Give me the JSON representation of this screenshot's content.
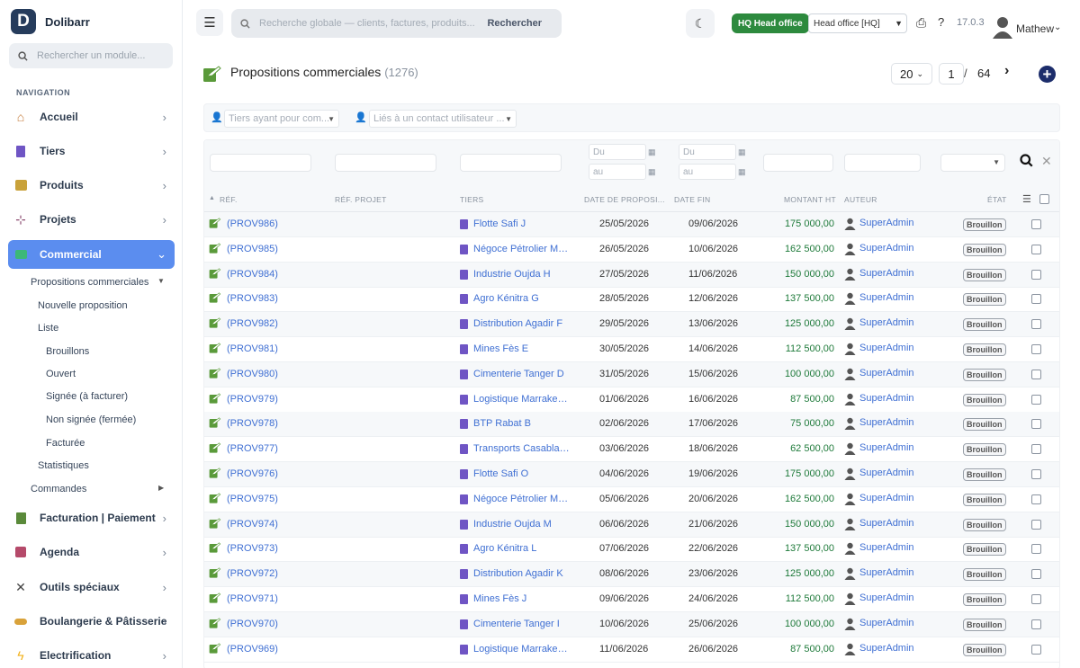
{
  "app": {
    "name": "Dolibarr",
    "logo_letter": "D"
  },
  "sidebar": {
    "search_placeholder": "Rechercher un module...",
    "nav_heading": "NAVIGATION",
    "items": [
      {
        "label": "Accueil",
        "icon": "home-icon"
      },
      {
        "label": "Tiers",
        "icon": "building-icon"
      },
      {
        "label": "Produits",
        "icon": "box-icon"
      },
      {
        "label": "Projets",
        "icon": "sitemap-icon"
      },
      {
        "label": "Commercial",
        "icon": "briefcase-icon"
      },
      {
        "label": "Facturation | Paiement",
        "icon": "invoice-icon"
      },
      {
        "label": "Agenda",
        "icon": "calendar-icon"
      },
      {
        "label": "Outils spéciaux",
        "icon": "tools-icon"
      },
      {
        "label": "Boulangerie & Pâtisserie",
        "icon": "bread-icon"
      },
      {
        "label": "Electrification",
        "icon": "bolt-icon"
      }
    ],
    "submenu": {
      "propositions": "Propositions commerciales",
      "nouvelle": "Nouvelle proposition",
      "liste": "Liste",
      "brouillons": "Brouillons",
      "ouvert": "Ouvert",
      "signee": "Signée (à facturer)",
      "non_signee": "Non signée (fermée)",
      "facturee": "Facturée",
      "statistiques": "Statistiques",
      "commandes": "Commandes"
    }
  },
  "header": {
    "search_placeholder": "Recherche globale — clients, factures, produits...",
    "search_button": "Rechercher",
    "hq_badge": "HQ  Head office",
    "entity": "Head office [HQ]",
    "version": "17.0.3",
    "user": "Mathew"
  },
  "page": {
    "title": "Propositions commerciales",
    "count": "(1276)",
    "page_size": "20",
    "page_current": "1",
    "page_separator": "/",
    "page_total": "64"
  },
  "filters": {
    "thirdparty_placeholder": "Tiers ayant pour com...",
    "contact_placeholder": "Liés à un contact utilisateur ..."
  },
  "search_row": {
    "date_from": "Du",
    "date_to": "au"
  },
  "columns": {
    "ref": "RÉF.",
    "ref_project": "RÉF. PROJET",
    "tiers": "TIERS",
    "date": "DATE DE PROPOSI...",
    "date_end": "DATE FIN",
    "amount": "MONTANT HT",
    "author": "AUTEUR",
    "status": "ÉTAT"
  },
  "rows": [
    {
      "ref": "(PROV986)",
      "tiers": "Flotte Safi J",
      "date": "25/05/2026",
      "date_end": "09/06/2026",
      "amount": "175 000,00",
      "author": "SuperAdmin",
      "status": "Brouillon"
    },
    {
      "ref": "(PROV985)",
      "tiers": "Négoce Pétrolier Mo...",
      "date": "26/05/2026",
      "date_end": "10/06/2026",
      "amount": "162 500,00",
      "author": "SuperAdmin",
      "status": "Brouillon"
    },
    {
      "ref": "(PROV984)",
      "tiers": "Industrie Oujda H",
      "date": "27/05/2026",
      "date_end": "11/06/2026",
      "amount": "150 000,00",
      "author": "SuperAdmin",
      "status": "Brouillon"
    },
    {
      "ref": "(PROV983)",
      "tiers": "Agro Kénitra G",
      "date": "28/05/2026",
      "date_end": "12/06/2026",
      "amount": "137 500,00",
      "author": "SuperAdmin",
      "status": "Brouillon"
    },
    {
      "ref": "(PROV982)",
      "tiers": "Distribution Agadir F",
      "date": "29/05/2026",
      "date_end": "13/06/2026",
      "amount": "125 000,00",
      "author": "SuperAdmin",
      "status": "Brouillon"
    },
    {
      "ref": "(PROV981)",
      "tiers": "Mines Fès E",
      "date": "30/05/2026",
      "date_end": "14/06/2026",
      "amount": "112 500,00",
      "author": "SuperAdmin",
      "status": "Brouillon"
    },
    {
      "ref": "(PROV980)",
      "tiers": "Cimenterie Tanger D",
      "date": "31/05/2026",
      "date_end": "15/06/2026",
      "amount": "100 000,00",
      "author": "SuperAdmin",
      "status": "Brouillon"
    },
    {
      "ref": "(PROV979)",
      "tiers": "Logistique Marrakec...",
      "date": "01/06/2026",
      "date_end": "16/06/2026",
      "amount": "87 500,00",
      "author": "SuperAdmin",
      "status": "Brouillon"
    },
    {
      "ref": "(PROV978)",
      "tiers": "BTP Rabat B",
      "date": "02/06/2026",
      "date_end": "17/06/2026",
      "amount": "75 000,00",
      "author": "SuperAdmin",
      "status": "Brouillon"
    },
    {
      "ref": "(PROV977)",
      "tiers": "Transports Casablan...",
      "date": "03/06/2026",
      "date_end": "18/06/2026",
      "amount": "62 500,00",
      "author": "SuperAdmin",
      "status": "Brouillon"
    },
    {
      "ref": "(PROV976)",
      "tiers": "Flotte Safi O",
      "date": "04/06/2026",
      "date_end": "19/06/2026",
      "amount": "175 000,00",
      "author": "SuperAdmin",
      "status": "Brouillon"
    },
    {
      "ref": "(PROV975)",
      "tiers": "Négoce Pétrolier Mo...",
      "date": "05/06/2026",
      "date_end": "20/06/2026",
      "amount": "162 500,00",
      "author": "SuperAdmin",
      "status": "Brouillon"
    },
    {
      "ref": "(PROV974)",
      "tiers": "Industrie Oujda M",
      "date": "06/06/2026",
      "date_end": "21/06/2026",
      "amount": "150 000,00",
      "author": "SuperAdmin",
      "status": "Brouillon"
    },
    {
      "ref": "(PROV973)",
      "tiers": "Agro Kénitra L",
      "date": "07/06/2026",
      "date_end": "22/06/2026",
      "amount": "137 500,00",
      "author": "SuperAdmin",
      "status": "Brouillon"
    },
    {
      "ref": "(PROV972)",
      "tiers": "Distribution Agadir K",
      "date": "08/06/2026",
      "date_end": "23/06/2026",
      "amount": "125 000,00",
      "author": "SuperAdmin",
      "status": "Brouillon"
    },
    {
      "ref": "(PROV971)",
      "tiers": "Mines Fès J",
      "date": "09/06/2026",
      "date_end": "24/06/2026",
      "amount": "112 500,00",
      "author": "SuperAdmin",
      "status": "Brouillon"
    },
    {
      "ref": "(PROV970)",
      "tiers": "Cimenterie Tanger I",
      "date": "10/06/2026",
      "date_end": "25/06/2026",
      "amount": "100 000,00",
      "author": "SuperAdmin",
      "status": "Brouillon"
    },
    {
      "ref": "(PROV969)",
      "tiers": "Logistique Marrakec...",
      "date": "11/06/2026",
      "date_end": "26/06/2026",
      "amount": "87 500,00",
      "author": "SuperAdmin",
      "status": "Brouillon"
    }
  ],
  "colors": {
    "accent": "#5b8def",
    "link": "#3f6fd3",
    "amount": "#1e7a3a",
    "hq": "#2d8a3e",
    "brand": "#263c5c"
  }
}
